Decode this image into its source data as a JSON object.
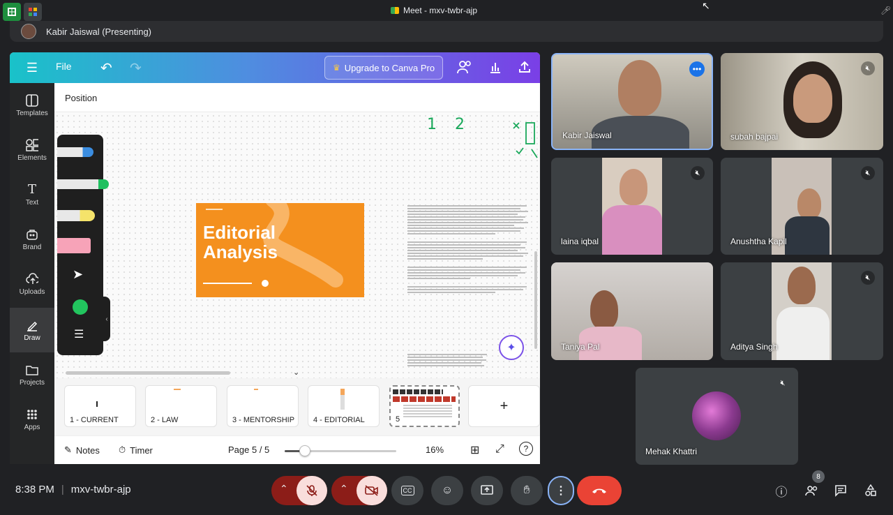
{
  "tab": {
    "title": "Meet - mxv-twbr-ajp"
  },
  "presenter": {
    "label": "Kabir Jaiswal (Presenting)"
  },
  "canva": {
    "header": {
      "file_label": "File",
      "upgrade_label": "Upgrade to Canva Pro"
    },
    "sidebar": [
      {
        "label": "Templates",
        "icon": "templates-icon"
      },
      {
        "label": "Elements",
        "icon": "elements-icon"
      },
      {
        "label": "Text",
        "icon": "text-icon"
      },
      {
        "label": "Brand",
        "icon": "brand-icon"
      },
      {
        "label": "Uploads",
        "icon": "uploads-icon"
      },
      {
        "label": "Draw",
        "icon": "draw-icon"
      },
      {
        "label": "Projects",
        "icon": "projects-icon"
      },
      {
        "label": "Apps",
        "icon": "apps-icon"
      }
    ],
    "position_label": "Position",
    "handwritten": {
      "one": "1",
      "two": "2"
    },
    "slide": {
      "title_line1": "Editorial",
      "title_line2": "Analysis"
    },
    "pages": [
      {
        "label": "1 - CURRENT"
      },
      {
        "label": "2 - LAW"
      },
      {
        "label": "3 - MENTORSHIP"
      },
      {
        "label": "4 - EDITORIAL"
      },
      {
        "label": "5"
      }
    ],
    "add_page": "+",
    "footer": {
      "notes": "Notes",
      "timer": "Timer",
      "page_indicator": "Page 5 / 5",
      "zoom": "16%",
      "zoom_fraction": 0.18
    }
  },
  "participants": [
    {
      "name": "Kabir Jaiswal",
      "active": true
    },
    {
      "name": "subah bajpai",
      "muted": true
    },
    {
      "name": "laina iqbal",
      "muted": true
    },
    {
      "name": "Anushtha Kapil",
      "muted": true
    },
    {
      "name": "Taniya Pal",
      "muted": true
    },
    {
      "name": "Aditya Singh",
      "muted": true
    },
    {
      "name": "Mehak Khattri",
      "muted": true
    }
  ],
  "footer": {
    "time": "8:38 PM",
    "meeting_code": "mxv-twbr-ajp",
    "participant_count": "8"
  },
  "colors": {
    "accent_blue": "#8ab4f8",
    "end_call_red": "#ea4335",
    "canva_purple": "#7a3fe6",
    "slide_orange": "#f4901e"
  }
}
